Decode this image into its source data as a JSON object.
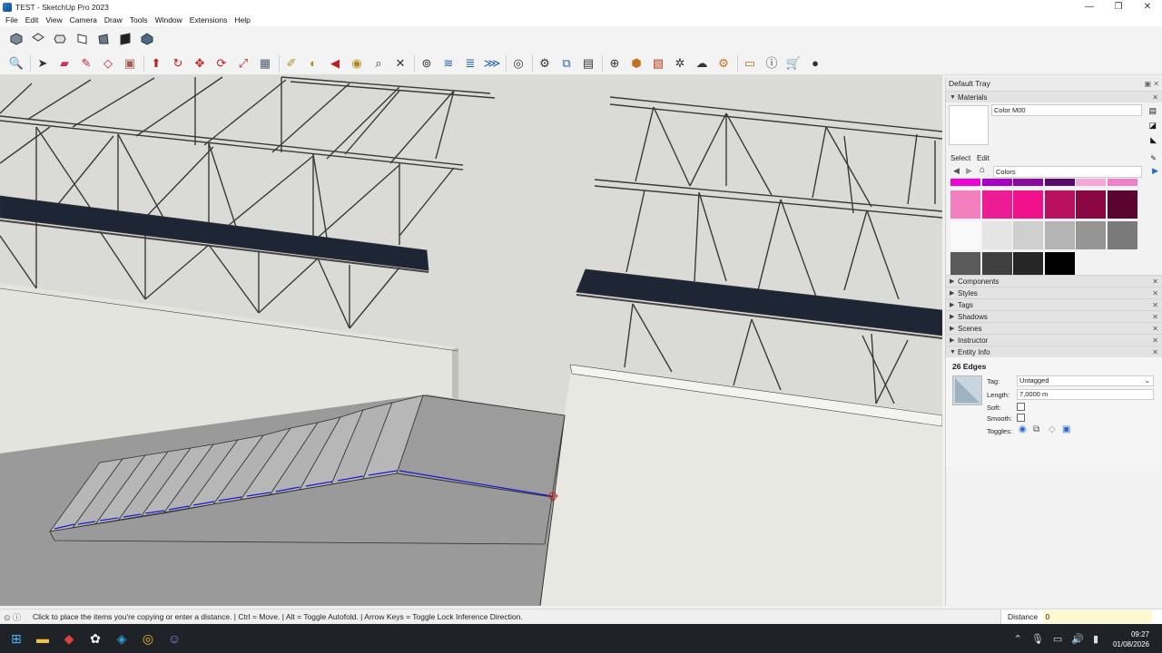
{
  "window": {
    "title": "TEST - SketchUp Pro 2023",
    "minimize": "—",
    "maximize": "❐",
    "close": "✕"
  },
  "menu": [
    "File",
    "Edit",
    "View",
    "Camera",
    "Draw",
    "Tools",
    "Window",
    "Extensions",
    "Help"
  ],
  "toolbar_views": [
    "iso-view-icon",
    "top-view-icon",
    "front-view-icon",
    "right-view-icon",
    "back-view-icon",
    "left-view-icon",
    "bottom-view-icon"
  ],
  "toolbar_main": [
    "zoom-extents-icon",
    "select-icon",
    "eraser-icon",
    "line-icon",
    "shapes-icon",
    "paint-bucket-icon",
    "push-pull-icon",
    "follow-me-icon",
    "move-icon",
    "rotate-icon",
    "scale-icon",
    "offset-icon",
    "tape-measure-icon",
    "protractor-icon",
    "text-icon",
    "orbit-icon",
    "zoom-icon",
    "zoom-window-icon",
    "section-plane-icon",
    "sandbox-icon",
    "layer-icon",
    "account-icon",
    "warehouse-icon",
    "components-icon",
    "tags-icon",
    "add-icon",
    "extensions-icon",
    "scenes-icon",
    "settings-icon",
    "cloud-icon",
    "preferences-icon",
    "door-icon",
    "info-icon",
    "cart-icon",
    "profile-icon"
  ],
  "tray": {
    "title": "Default Tray",
    "materials": {
      "header": "Materials",
      "color_name": "Color M00",
      "tab_select": "Select",
      "tab_edit": "Edit",
      "library": "Colors",
      "swatches": [
        "#f000d8",
        "#a800c8",
        "#8a0aa0",
        "#5a0a6a",
        "#f5a8d8",
        "#f080c8",
        "#f47fbf",
        "#ec1c95",
        "#f0118b",
        "#b8105e",
        "#8a0742",
        "#5a0530",
        "#fafafa",
        "#e5e5e5",
        "#cfcfcf",
        "#b4b4b4",
        "#959595",
        "#7a7a7a",
        "#5a5a5a",
        "#3f3f3f",
        "#262626",
        "#000000"
      ]
    },
    "panels": [
      "Components",
      "Styles",
      "Tags",
      "Shadows",
      "Scenes",
      "Instructor"
    ],
    "entity": {
      "header": "Entity Info",
      "title": "26 Edges",
      "tag_label": "Tag:",
      "tag_value": "Untagged",
      "length_label": "Length:",
      "length_value": "7,0000 m",
      "soft_label": "Soft:",
      "smooth_label": "Smooth:",
      "toggles_label": "Toggles:"
    }
  },
  "status": {
    "message": "Click to place the items you're copying or enter a distance. | Ctrl = Move. | Alt = Toggle Autofold. | Arrow Keys = Toggle Lock Inference Direction.",
    "measure_label": "Distance",
    "measure_value": "0"
  },
  "taskbar": {
    "time": "09:27",
    "date": "01/08/2026"
  }
}
